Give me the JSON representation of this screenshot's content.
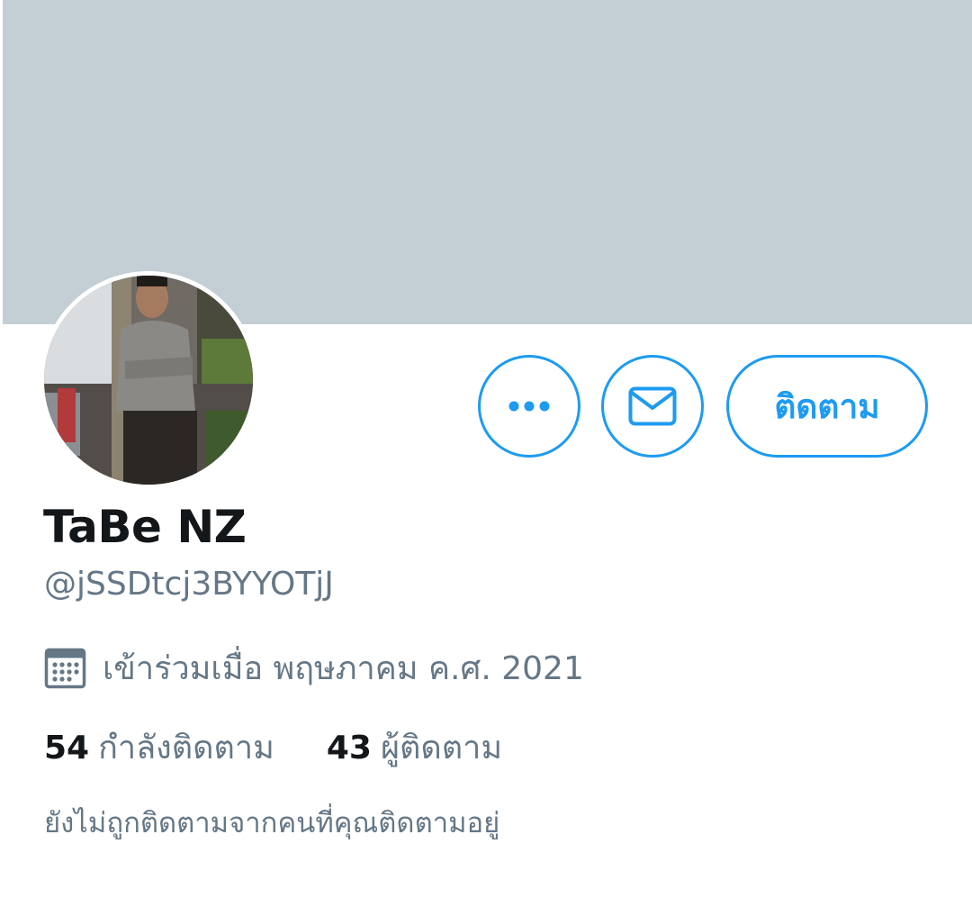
{
  "profile": {
    "display_name": "TaBe NZ",
    "handle": "@jSSDtcj3BYYOTjJ",
    "joined": "เข้าร่วมเมื่อ พฤษภาคม ค.ศ. 2021",
    "following_count": "54",
    "following_label": "กำลังติดตาม",
    "followers_count": "43",
    "followers_label": "ผู้ติดตาม",
    "not_followed_notice": "ยังไม่ถูกติดตามจากคนที่คุณติดตามอยู่"
  },
  "actions": {
    "more_icon": "more-horizontal-icon",
    "message_icon": "envelope-icon",
    "follow_label": "ติดตาม"
  },
  "icons": {
    "joined_icon": "calendar-icon"
  },
  "colors": {
    "accent": "#1d9bf0",
    "banner": "#c4cfd5",
    "primary_text": "#14171a",
    "secondary_text": "#657786"
  }
}
